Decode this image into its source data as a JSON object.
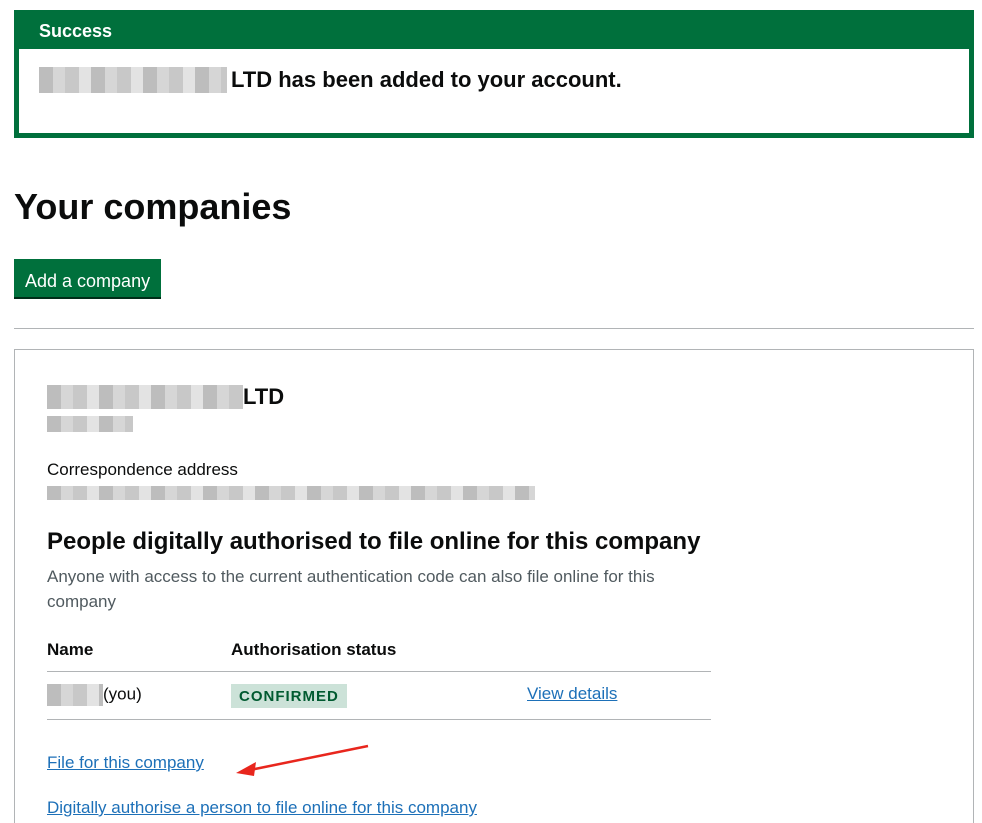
{
  "banner": {
    "title": "Success",
    "message_suffix": "LTD has been added to your account."
  },
  "page": {
    "title": "Your companies",
    "add_button": "Add a company"
  },
  "company": {
    "name_suffix": "LTD",
    "correspondence_label": "Correspondence address",
    "section_title": "People digitally authorised to file online for this company",
    "section_desc": "Anyone with access to the current authentication code can also file online for this company",
    "table": {
      "headers": [
        "Name",
        "Authorisation status"
      ],
      "rows": [
        {
          "name_suffix": "(you)",
          "status": "CONFIRMED",
          "action": "View details"
        }
      ]
    },
    "links": {
      "file": "File for this company",
      "authorise": "Digitally authorise a person to file online for this company"
    }
  },
  "colors": {
    "brand_green": "#00703c",
    "link_blue": "#1d70b8",
    "tag_bg": "#cce2d8",
    "tag_text": "#005a30",
    "annotation_red": "#e8261d"
  },
  "icons": {
    "annotation": "red-arrow-icon"
  }
}
